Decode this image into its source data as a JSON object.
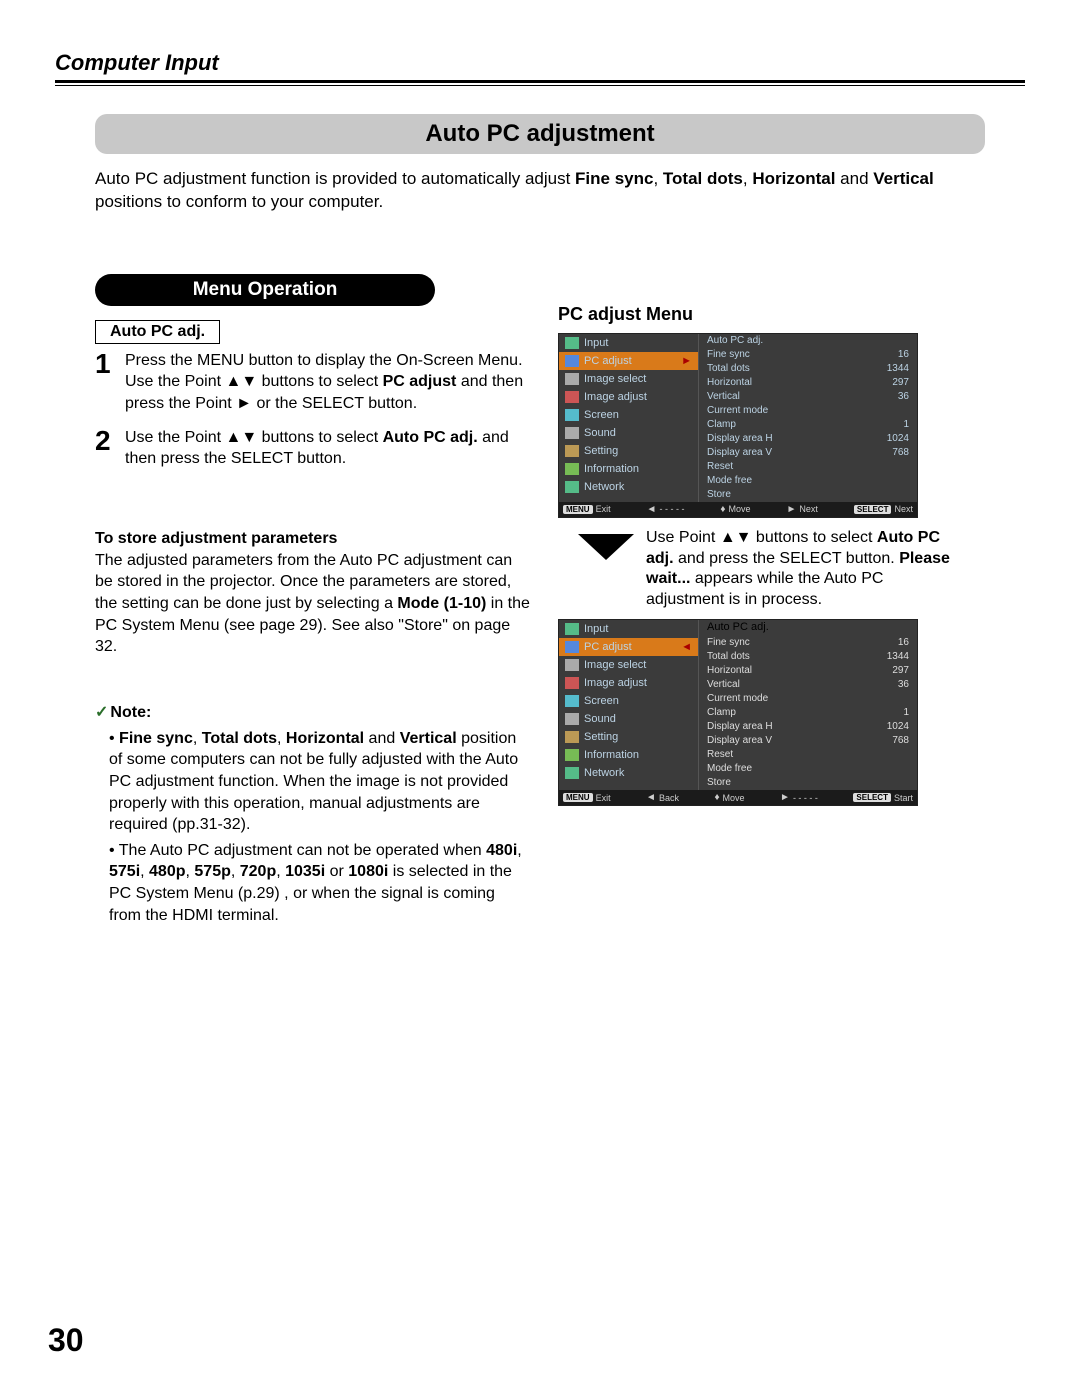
{
  "page_number": "30",
  "crumb": "Computer Input",
  "title": "Auto PC adjustment",
  "intro_html": "Auto PC adjustment function is provided to automatically adjust <b>Fine sync</b>, <b>Total dots</b>, <b>Horizontal</b> and <b>Vertical</b> positions to conform to your computer.",
  "pill": "Menu Operation",
  "tag": "Auto PC adj.",
  "steps": [
    {
      "n": "1",
      "html": "Press the MENU button to display the On-Screen Menu. Use the Point ▲▼ buttons to select <b>PC adjust</b> and then press the Point ► or the SELECT button."
    },
    {
      "n": "2",
      "html": "Use the Point ▲▼ buttons to select <b>Auto PC adj.</b> and then press the SELECT button."
    }
  ],
  "store_head": "To store adjustment parameters",
  "store_body_html": "The adjusted parameters from the Auto PC adjustment can be stored in the projector. Once the parameters are stored, the setting can be done just by selecting a <b>Mode (1-10)</b> in the PC System Menu (see page 29). See also \"Store\" on page 32.",
  "note_head": "Note:",
  "notes": [
    "<b>Fine sync</b>, <b>Total dots</b>, <b>Horizontal</b> and <b>Vertical</b> position of some computers can not be fully adjusted with the Auto PC adjustment function. When the image is not provided properly with this operation, manual adjustments are required (pp.31-32).",
    "The Auto PC adjustment can not be operated when <b>480i</b>, <b>575i</b>, <b>480p</b>, <b>575p</b>, <b>720p</b>, <b>1035i</b> or <b>1080i</b> is selected in the PC System Menu (p.29) , or when the signal is coming from the HDMI terminal."
  ],
  "menu_title": "PC adjust Menu",
  "arrow_html": "Use Point ▲▼ buttons to select <b>Auto PC adj.</b> and press the SELECT button. <b>Please wait...</b> appears while the Auto PC adjustment is in process.",
  "osd_left": [
    "Input",
    "PC adjust",
    "Image select",
    "Image adjust",
    "Screen",
    "Sound",
    "Setting",
    "Information",
    "Network"
  ],
  "osd_values": [
    {
      "k": "Auto PC adj.",
      "v": ""
    },
    {
      "k": "Fine sync",
      "v": "16"
    },
    {
      "k": "Total dots",
      "v": "1344"
    },
    {
      "k": "Horizontal",
      "v": "297"
    },
    {
      "k": "Vertical",
      "v": "36"
    },
    {
      "k": "Current mode",
      "v": ""
    },
    {
      "k": "Clamp",
      "v": "1"
    },
    {
      "k": "Display area H",
      "v": "1024"
    },
    {
      "k": "Display area V",
      "v": "768"
    },
    {
      "k": "Reset",
      "v": ""
    },
    {
      "k": "Mode free",
      "v": ""
    },
    {
      "k": "Store",
      "v": ""
    }
  ],
  "foot1": [
    {
      "key": "MENU",
      "t": "Exit"
    },
    {
      "sym": "◄",
      "t": "- - - - -"
    },
    {
      "sym": "♦",
      "t": "Move"
    },
    {
      "sym": "►",
      "t": "Next"
    },
    {
      "key": "SELECT",
      "t": "Next"
    }
  ],
  "foot2": [
    {
      "key": "MENU",
      "t": "Exit"
    },
    {
      "sym": "◄",
      "t": "Back"
    },
    {
      "sym": "♦",
      "t": "Move"
    },
    {
      "sym": "►",
      "t": "- - - - -"
    },
    {
      "key": "SELECT",
      "t": "Start"
    }
  ]
}
